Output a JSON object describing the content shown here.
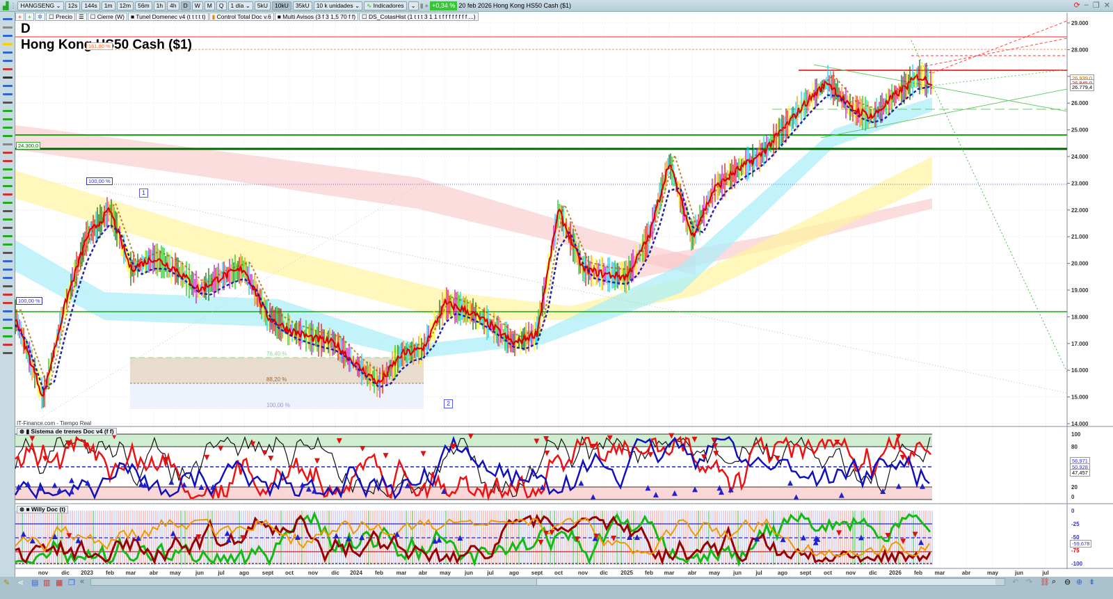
{
  "toolbar": {
    "symbol": "HANGSENG",
    "intervals": [
      "12s",
      "144s",
      "1m",
      "12m",
      "56m",
      "1h",
      "4h",
      "D",
      "W",
      "M",
      "Q"
    ],
    "active_interval": "D",
    "period": "1 día",
    "units_buttons": [
      "5kU",
      "10kU",
      "35kU"
    ],
    "active_unit": "10kU",
    "units_select": "10 k unidades",
    "indicators_label": "Indicadores",
    "change_pct": "+0,34 %",
    "date": "20 feb 2026",
    "instrument": "Hong Kong HS50 Cash ($1)"
  },
  "indicator_row": [
    "Precio",
    "Cierre (W)",
    "Tunel Domenec v4 (t t t t t)",
    "Control Total Doc v.6",
    "Multi Avisos (3 f 3 1,5 70 f f)",
    "DS_CotasHist (1 t t t 3 1 1 t f f f f f f f f ...)"
  ],
  "chart": {
    "timeframe": "D",
    "title": "Hong Kong HS50 Cash ($1)",
    "source": "IT-Finance.com - Tiempo Real",
    "fib_labels": {
      "f1618": "161,80 %",
      "f100a": "100,00 %",
      "f100b": "100,00 %",
      "f764": "76,40 %",
      "f882": "88,20 %",
      "f100c": "100,00 %"
    },
    "level_label": "24.300,0",
    "wave_labels": [
      "1",
      "2"
    ],
    "last_price_labels": [
      "26.939,0",
      "26.845,0",
      "26.779,4"
    ]
  },
  "chart_data": {
    "type": "line",
    "title": "Hong Kong HS50 Cash ($1)",
    "y_ticks": [
      "29.000",
      "28.000",
      "27.000",
      "26.000",
      "25.000",
      "24.000",
      "23.000",
      "22.000",
      "21.000",
      "20.000",
      "19.000",
      "18.000",
      "17.000",
      "16.000",
      "15.000",
      "14.000"
    ],
    "ylim": [
      14000,
      29000
    ],
    "series": [
      {
        "name": "price",
        "x_months": [
          0,
          1,
          2,
          3,
          4,
          5,
          6,
          7,
          8,
          9,
          10,
          11,
          12,
          13,
          14,
          15,
          16,
          17,
          18,
          19,
          20,
          21,
          22,
          23,
          24,
          25,
          26,
          27,
          28,
          29,
          30,
          31,
          32,
          33,
          34,
          35,
          36,
          37,
          38,
          39,
          40,
          40.6
        ],
        "values": [
          18000,
          15000,
          18500,
          21000,
          22000,
          19800,
          20200,
          19800,
          19000,
          19500,
          19800,
          18000,
          17500,
          17200,
          17000,
          16200,
          15500,
          16600,
          16800,
          18500,
          18200,
          17700,
          17000,
          17400,
          22000,
          19800,
          19600,
          19500,
          21000,
          23800,
          21000,
          22800,
          23500,
          24000,
          25000,
          26000,
          26800,
          25800,
          25500,
          26300,
          27000,
          26780
        ]
      }
    ],
    "x_ticks": [
      "nov",
      "dic",
      "2023",
      "feb",
      "mar",
      "abr",
      "may",
      "jun",
      "jul",
      "ago",
      "sept",
      "oct",
      "nov",
      "dic",
      "2024",
      "feb",
      "mar",
      "abr",
      "may",
      "jun",
      "jul",
      "ago",
      "sept",
      "oct",
      "nov",
      "dic",
      "2025",
      "feb",
      "mar",
      "abr",
      "may",
      "jun",
      "jul",
      "ago",
      "sept",
      "oct",
      "nov",
      "dic",
      "2026",
      "feb",
      "mar",
      "abr",
      "may",
      "jun",
      "jul"
    ]
  },
  "osc1": {
    "name": "Sistema de trenes Doc v4 (f f)",
    "ticks": [
      "100",
      "80",
      "20",
      "0"
    ],
    "values": [
      "56,971",
      "50,928",
      "47,457"
    ]
  },
  "osc2": {
    "name": "Willy Doc (t)",
    "ticks": [
      "0",
      "-25",
      "-50",
      "-75",
      "-100"
    ],
    "value": "-59,678"
  },
  "colors": {
    "up": "#00c000",
    "down": "#e00000",
    "accent": "#3bc43b"
  }
}
